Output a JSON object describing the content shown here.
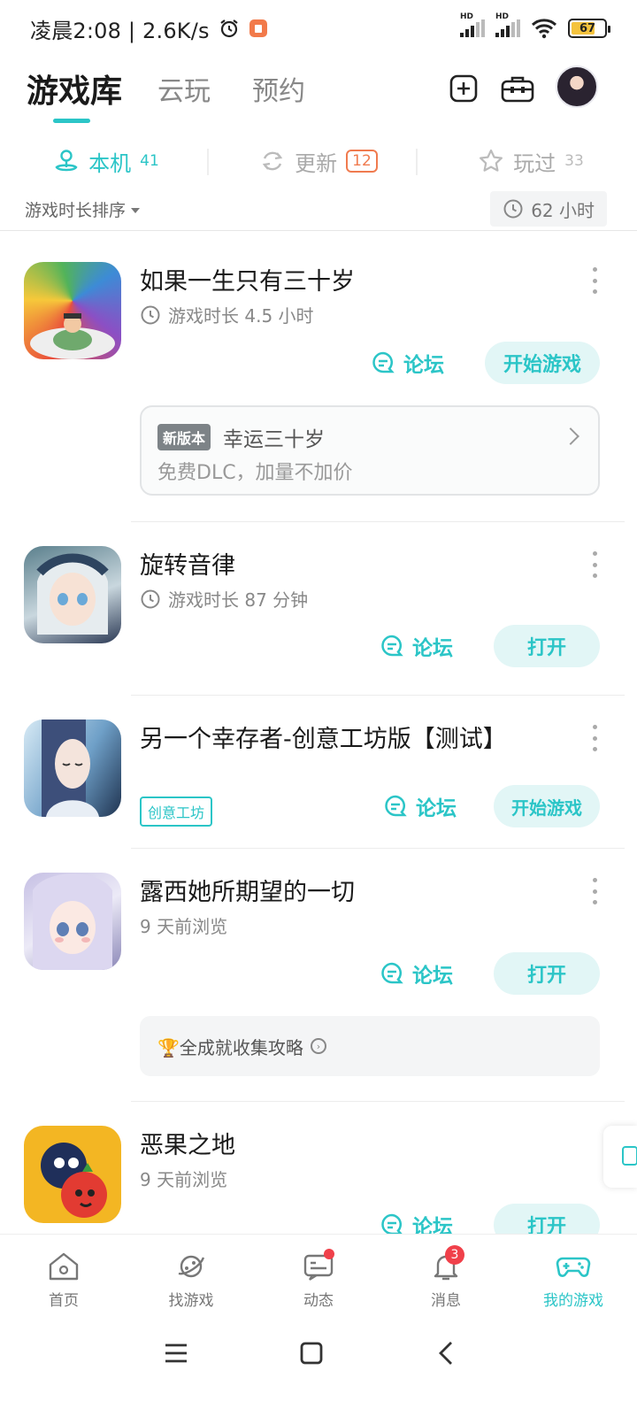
{
  "status_bar": {
    "time_speed": "凌晨2:08 | 2.6K/s",
    "signal_1_label": "HD",
    "signal_2_label": "HD",
    "battery": "67"
  },
  "header": {
    "tabs": [
      "游戏库",
      "云玩",
      "预约"
    ]
  },
  "filters": {
    "local_label": "本机",
    "local_count": "41",
    "update_label": "更新",
    "update_count": "12",
    "played_label": "玩过",
    "played_count": "33"
  },
  "sort": {
    "label": "游戏时长排序",
    "total_time": "62 小时"
  },
  "games": [
    {
      "title": "如果一生只有三十岁",
      "sub": "游戏时长 4.5 小时",
      "forum": "论坛",
      "action": "开始游戏",
      "dlc": {
        "tag": "新版本",
        "title": "幸运三十岁",
        "desc": "免费DLC，加量不加价"
      }
    },
    {
      "title": "旋转音律",
      "sub": "游戏时长 87 分钟",
      "forum": "论坛",
      "action": "打开"
    },
    {
      "title": "另一个幸存者-创意工坊版【测试】",
      "tag": "创意工坊",
      "forum": "论坛",
      "action": "开始游戏"
    },
    {
      "title": "露西她所期望的一切",
      "sub": "9 天前浏览",
      "forum": "论坛",
      "action": "打开",
      "guide": "🏆全成就收集攻略"
    },
    {
      "title": "恶果之地",
      "sub": "9 天前浏览",
      "forum": "论坛",
      "action": "打开"
    }
  ],
  "bottom_nav": {
    "items": [
      "首页",
      "找游戏",
      "动态",
      "消息",
      "我的游戏"
    ],
    "message_badge": "3"
  },
  "accent_color": "#2bc5c7"
}
